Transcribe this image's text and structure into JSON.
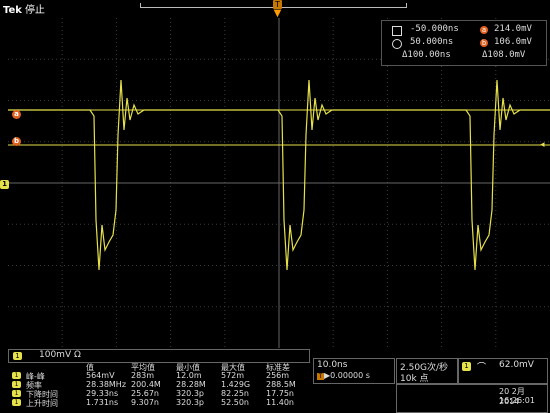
{
  "header": {
    "brand": "Tek",
    "status": "停止",
    "trigger_marker": "T"
  },
  "markers": {
    "a": "a",
    "b": "b",
    "ch1": "1"
  },
  "cursors": {
    "row1": {
      "time": "-50.000ns",
      "volt": "214.0mV"
    },
    "row2": {
      "time": "50.000ns",
      "volt": "106.0mV"
    },
    "row3": {
      "dtime": "Δ100.00ns",
      "dvolt": "Δ108.0mV"
    }
  },
  "channel": {
    "num": "1",
    "scale": "100mV",
    "coupling": "Ω"
  },
  "measurements": {
    "headers": [
      "值",
      "平均值",
      "最小值",
      "最大值",
      "标准差"
    ],
    "rows": [
      {
        "name": "峰-峰",
        "vals": [
          "564mV",
          "283m",
          "12.0m",
          "572m",
          "256m"
        ]
      },
      {
        "name": "频率",
        "vals": [
          "28.38MHz",
          "200.4M",
          "28.28M",
          "1.429G",
          "288.5M"
        ]
      },
      {
        "name": "下降时间",
        "vals": [
          "29.33ns",
          "25.67n",
          "82.25n",
          "17.75n"
        ]
      },
      {
        "name": "上升时间",
        "vals": [
          "1.731ns",
          "9.307n",
          "320.3p",
          "52.50n",
          "11.40n"
        ]
      }
    ],
    "row3_min": "320.3p"
  },
  "timebase": {
    "scale": "10.0ns",
    "offset": "▶0.00000 s"
  },
  "acq": {
    "rate": "2.50G次/秒",
    "points": "10k 点"
  },
  "trigger": {
    "icon": "edge",
    "slope": "⌒",
    "level": "62.0mV"
  },
  "datetime": {
    "date": "20 2月 2014",
    "time": "16:26:01"
  },
  "colors": {
    "ch1": "#e6e14a",
    "cursor": "#e06020",
    "grid": "#3b3b3b"
  }
}
